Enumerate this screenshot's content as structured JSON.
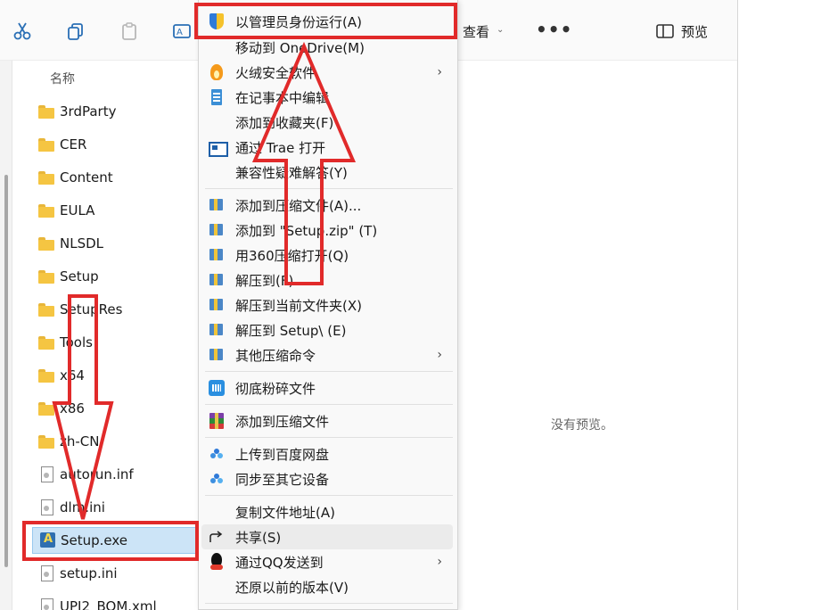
{
  "toolbar": {
    "view_label": "查看",
    "preview_label": "预览",
    "more_label": "•••"
  },
  "filelist": {
    "column_header": "名称",
    "items": [
      {
        "name": "3rdParty",
        "type": "folder"
      },
      {
        "name": "CER",
        "type": "folder"
      },
      {
        "name": "Content",
        "type": "folder"
      },
      {
        "name": "EULA",
        "type": "folder"
      },
      {
        "name": "NLSDL",
        "type": "folder"
      },
      {
        "name": "Setup",
        "type": "folder"
      },
      {
        "name": "SetupRes",
        "type": "folder"
      },
      {
        "name": "Tools",
        "type": "folder"
      },
      {
        "name": "x64",
        "type": "folder"
      },
      {
        "name": "x86",
        "type": "folder"
      },
      {
        "name": "zh-CN",
        "type": "folder"
      },
      {
        "name": "autorun.inf",
        "type": "file"
      },
      {
        "name": "dlm.ini",
        "type": "file"
      },
      {
        "name": "Setup.exe",
        "type": "exe",
        "selected": true
      },
      {
        "name": "setup.ini",
        "type": "file"
      },
      {
        "name": "UPI2_BOM.xml",
        "type": "file"
      }
    ]
  },
  "preview": {
    "empty_text": "没有预览。"
  },
  "context_menu": {
    "items": [
      {
        "label": "以管理员身份运行(A)",
        "icon": "uac-shield-icon"
      },
      {
        "label": "移动到 OneDrive(M)",
        "icon": ""
      },
      {
        "label": "火绒安全软件",
        "icon": "huorong-icon",
        "submenu": true
      },
      {
        "label": "在记事本中编辑",
        "icon": "notepad-icon"
      },
      {
        "label": "添加到收藏夹(F)",
        "icon": ""
      },
      {
        "label": "通过 Trae 打开",
        "icon": "trae-icon"
      },
      {
        "label": "兼容性疑难解答(Y)",
        "icon": ""
      },
      {
        "label": "添加到压缩文件(A)...",
        "icon": "archive-icon"
      },
      {
        "label": "添加到 \"Setup.zip\" (T)",
        "icon": "archive-icon"
      },
      {
        "label": "用360压缩打开(Q)",
        "icon": "archive-icon"
      },
      {
        "label": "解压到(F)",
        "icon": "archive-icon"
      },
      {
        "label": "解压到当前文件夹(X)",
        "icon": "archive-icon"
      },
      {
        "label": "解压到 Setup\\ (E)",
        "icon": "archive-icon"
      },
      {
        "label": "其他压缩命令",
        "icon": "archive-icon",
        "submenu": true
      },
      {
        "label": "彻底粉碎文件",
        "icon": "shredder-icon"
      },
      {
        "label": "添加到压缩文件",
        "icon": "winrar-icon"
      },
      {
        "label": "上传到百度网盘",
        "icon": "baidu-cloud-icon"
      },
      {
        "label": "同步至其它设备",
        "icon": "baidu-cloud-icon"
      },
      {
        "label": "复制文件地址(A)",
        "icon": ""
      },
      {
        "label": "共享(S)",
        "icon": "share-icon"
      },
      {
        "label": "通过QQ发送到",
        "icon": "qq-icon",
        "submenu": true
      },
      {
        "label": "还原以前的版本(V)",
        "icon": ""
      }
    ],
    "submenu_arrow": "›"
  },
  "colors": {
    "annotation_red": "#e12a2a",
    "selection_blue": "#cce4f7",
    "menu_bg": "#f9f9f9"
  }
}
